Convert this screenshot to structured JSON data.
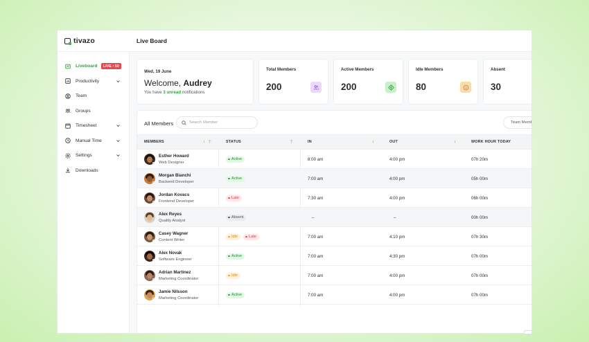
{
  "app": {
    "brand": "tivazo",
    "page_title": "Live Board"
  },
  "sidebar": {
    "items": [
      {
        "label": "Liveboard",
        "icon": "live-icon",
        "badge": "LIVE • 50",
        "active": true
      },
      {
        "label": "Productivity",
        "icon": "productivity-icon",
        "expandable": true
      },
      {
        "label": "Team",
        "icon": "team-icon"
      },
      {
        "label": "Groups",
        "icon": "groups-icon"
      },
      {
        "label": "Timesheet",
        "icon": "timesheet-icon",
        "expandable": true
      },
      {
        "label": "Manual Time",
        "icon": "clock-icon",
        "expandable": true
      },
      {
        "label": "Settings",
        "icon": "gear-icon",
        "expandable": true
      },
      {
        "label": "Downloads",
        "icon": "download-icon"
      }
    ]
  },
  "welcome": {
    "date": "Wed, 19 June",
    "greeting": "Welcome,",
    "name": "Audrey",
    "notice_prefix": "You have",
    "notice_count": "3 unread",
    "notice_suffix": "notifications"
  },
  "stats": [
    {
      "label": "Total Members",
      "value": "200",
      "icon": "users-icon",
      "color": "#c9a7f0"
    },
    {
      "label": "Active Members",
      "value": "200",
      "icon": "active-icon",
      "color": "#8fe08f"
    },
    {
      "label": "Idle Members",
      "value": "80",
      "icon": "idle-icon",
      "color": "#f5b75a"
    },
    {
      "label": "Absent",
      "value": "30"
    }
  ],
  "members": {
    "title": "All Members",
    "search_placeholder": "Search Member",
    "team_filter": "Team Memb",
    "columns": {
      "members": "MEMBERS",
      "status": "STATUS",
      "in": "IN",
      "out": "OUT",
      "work": "WORK HOUR TODAY"
    },
    "rows": [
      {
        "name": "Esther Howard",
        "role": "Web Designer",
        "status": [
          [
            "Active",
            "active"
          ]
        ],
        "in": "8:00 am",
        "out": "4:00 pm",
        "work": "07h 20m"
      },
      {
        "name": "Morgan Bianchi",
        "role": "Backend Developer",
        "status": [
          [
            "Active",
            "active"
          ]
        ],
        "in": "7:00 am",
        "out": "4:00 pm",
        "work": "05h 00m"
      },
      {
        "name": "Jordan Kovacs",
        "role": "Frontend Developer",
        "status": [
          [
            "Late",
            "late"
          ]
        ],
        "in": "7:30 am",
        "out": "4:00 pm",
        "work": "06h 00m"
      },
      {
        "name": "Alex Reyes",
        "role": "Quality Analyst",
        "status": [
          [
            "Absent",
            "absent"
          ]
        ],
        "in": "–",
        "out": "–",
        "work": "00h 00m"
      },
      {
        "name": "Casey Wagner",
        "role": "Content Writer",
        "status": [
          [
            "Idle",
            "idle"
          ],
          [
            "Late",
            "late"
          ]
        ],
        "in": "7:00 am",
        "out": "4:10 pm",
        "work": "07h 30m"
      },
      {
        "name": "Alex Novak",
        "role": "Software Engineer",
        "status": [
          [
            "Active",
            "active"
          ]
        ],
        "in": "7:00 am",
        "out": "4:30 pm",
        "work": "07h 00m"
      },
      {
        "name": "Adrian Martinez",
        "role": "Marketing Coordinator",
        "status": [
          [
            "Idle",
            "idle"
          ]
        ],
        "in": "7:00 am",
        "out": "4:00 pm",
        "work": "07h 00m"
      },
      {
        "name": "Jamie Nilsson",
        "role": "Marketing Coordinator",
        "status": [
          [
            "Active",
            "active"
          ]
        ],
        "in": "7:00 am",
        "out": "4:00 pm",
        "work": "07h 00m"
      }
    ]
  }
}
